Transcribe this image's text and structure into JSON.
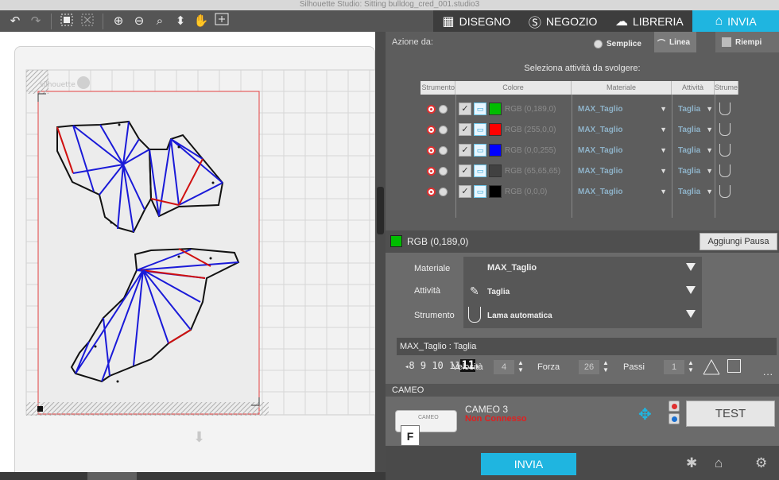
{
  "window": {
    "title": "Silhouette Studio: Sitting bulldog_cred_001.studio3"
  },
  "toolbar": {
    "icons": [
      "undo-icon",
      "redo-icon",
      "group-icon",
      "ungroup-icon",
      "zoom-in-icon",
      "zoom-out-icon",
      "zoom-fit-icon",
      "move-down-icon",
      "pan-hand-icon",
      "add-page-icon"
    ]
  },
  "tabs": [
    {
      "label": "DISEGNO",
      "icon": "grid-icon"
    },
    {
      "label": "NEGOZIO",
      "icon": "store-icon"
    },
    {
      "label": "LIBRERIA",
      "icon": "cloud-icon"
    },
    {
      "label": "INVIA",
      "icon": "cutter-icon",
      "active": true
    }
  ],
  "send_panel": {
    "azione_label": "Azione da:",
    "modes": {
      "semplice": "Semplice",
      "linea": "Linea",
      "riempi": "Riempi"
    },
    "select_label": "Seleziona attività da svolgere:",
    "table": {
      "headers": {
        "tool_left": "Strumento",
        "color": "Colore",
        "material": "Materiale",
        "task": "Attività",
        "tool_right": "Strumento"
      },
      "rows": [
        {
          "rgb": "RGB (0,189,0)",
          "swatch": "#00bd00",
          "material": "MAX_Taglio",
          "task": "Taglia"
        },
        {
          "rgb": "RGB (255,0,0)",
          "swatch": "#ff0000",
          "material": "MAX_Taglio",
          "task": "Taglia"
        },
        {
          "rgb": "RGB (0,0,255)",
          "swatch": "#0000ff",
          "material": "MAX_Taglio",
          "task": "Taglia"
        },
        {
          "rgb": "RGB (65,65,65)",
          "swatch": "#414141",
          "material": "MAX_Taglio",
          "task": "Taglia"
        },
        {
          "rgb": "RGB (0,0,0)",
          "swatch": "#000000",
          "material": "MAX_Taglio",
          "task": "Taglia"
        }
      ]
    },
    "selected": {
      "rgb": "RGB (0,189,0)",
      "swatch": "#00bd00",
      "add_pause": "Aggiungi Pausa"
    },
    "props": {
      "material_label": "Materiale",
      "material_value": "MAX_Taglio",
      "task_label": "Attività",
      "task_value": "Taglia",
      "tool_label": "Strumento",
      "tool_value": "Lama automatica"
    },
    "cut_header": "MAX_Taglio : Taglia",
    "params": {
      "blade_digits": "8 9 10 11",
      "blade_selected": "11",
      "speed_label": "Velocità",
      "speed": "4",
      "force_label": "Forza",
      "force": "26",
      "passes_label": "Passi",
      "passes": "1",
      "more": "..."
    },
    "device": {
      "section_label": "CAMEO",
      "name": "CAMEO 3",
      "status": "Non Connesso",
      "status_color": "#e02020",
      "printer_brand": "CAMEO",
      "printer_letter": "F",
      "test_label": "TEST"
    },
    "send_button": "INVIA"
  },
  "canvas": {
    "mat_logo": "silhouette",
    "accent": "#1fb5e0"
  }
}
